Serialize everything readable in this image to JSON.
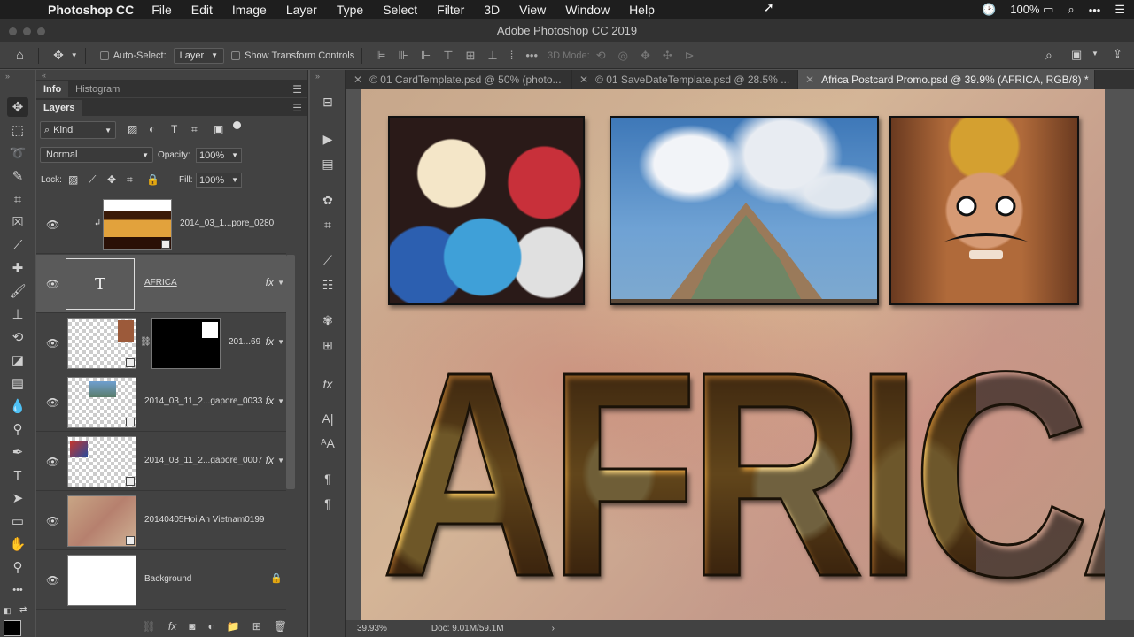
{
  "menubar": {
    "app_name": "Photoshop CC",
    "items": [
      "File",
      "Edit",
      "Image",
      "Layer",
      "Type",
      "Select",
      "Filter",
      "3D",
      "View",
      "Window",
      "Help"
    ],
    "battery": "100%"
  },
  "window_title": "Adobe Photoshop CC 2019",
  "options_bar": {
    "auto_select_label": "Auto-Select:",
    "auto_select_value": "Layer",
    "show_transform_label": "Show Transform Controls",
    "mode_3d_label": "3D Mode:"
  },
  "panel": {
    "tabs": [
      "Info",
      "Histogram"
    ],
    "layers_tab": "Layers",
    "filter_kind": "Kind",
    "blend_mode": "Normal",
    "opacity_label": "Opacity:",
    "opacity_value": "100%",
    "lock_label": "Lock:",
    "fill_label": "Fill:",
    "fill_value": "100%",
    "layers": [
      {
        "name": "2014_03_1...pore_0280",
        "fx": ""
      },
      {
        "name": "AFRICA",
        "fx": "fx"
      },
      {
        "name": "201...69",
        "fx": "fx"
      },
      {
        "name": "2014_03_11_2...gapore_0033",
        "fx": "fx"
      },
      {
        "name": "2014_03_11_2...gapore_0007",
        "fx": "fx"
      },
      {
        "name": "20140405Hoi An Vietnam0199",
        "fx": ""
      },
      {
        "name": "Background",
        "fx": ""
      }
    ]
  },
  "doc_tabs": [
    {
      "title": "© 01 CardTemplate.psd @ 50% (photo..."
    },
    {
      "title": "© 01 SaveDateTemplate.psd @ 28.5% ..."
    },
    {
      "title": "Africa Postcard Promo.psd @ 39.9% (AFRICA, RGB/8) *"
    }
  ],
  "canvas": {
    "headline": "AFRICA"
  },
  "status": {
    "zoom": "39.93%",
    "doc": "Doc: 9.01M/59.1M"
  },
  "colors": {
    "menubar_bg": "#1e1e1e",
    "panel_bg": "#424242",
    "selected_layer": "#5a5a5a"
  }
}
